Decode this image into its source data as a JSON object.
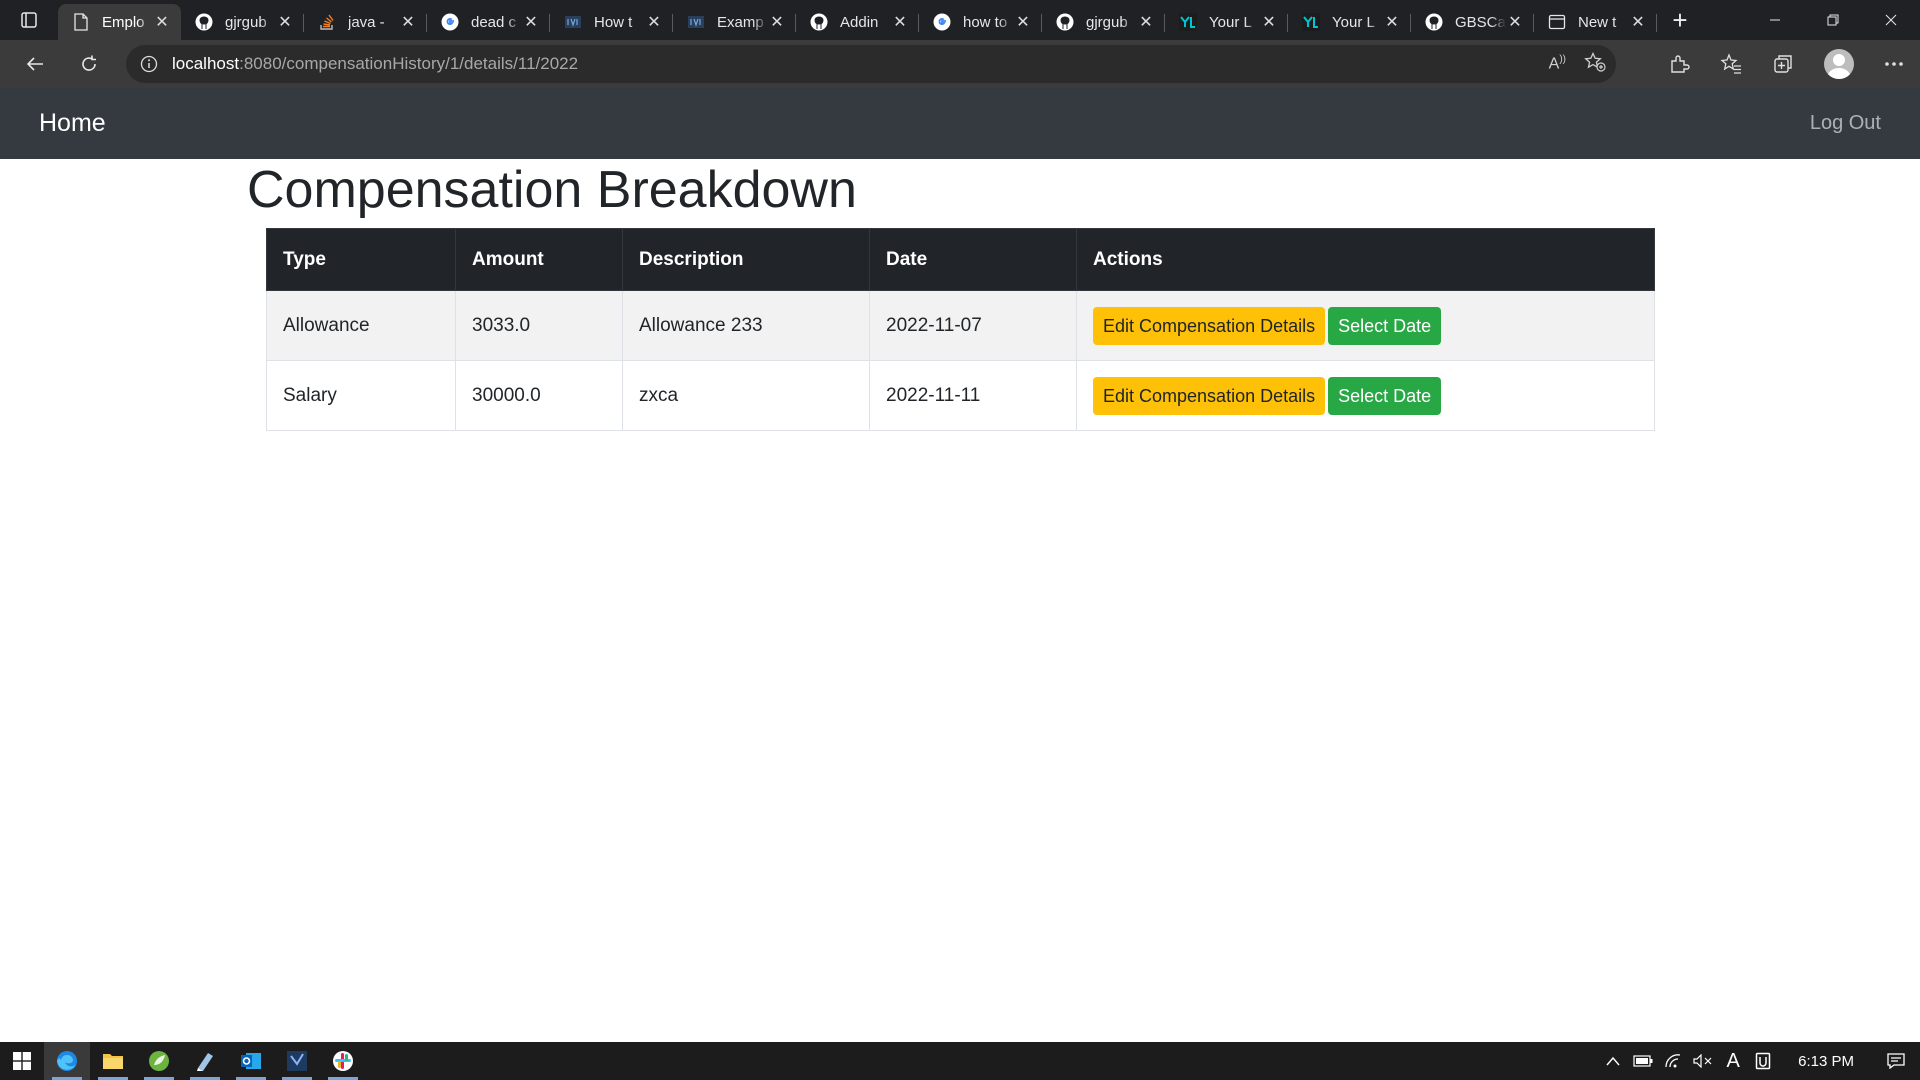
{
  "browser": {
    "tabs": [
      {
        "title": "Emplo",
        "icon": "page-icon",
        "active": true
      },
      {
        "title": "gjrgub",
        "icon": "github-icon"
      },
      {
        "title": "java -",
        "icon": "stackoverflow-icon"
      },
      {
        "title": "dead c",
        "icon": "google-icon"
      },
      {
        "title": "How t",
        "icon": "site-icon"
      },
      {
        "title": "Examp",
        "icon": "site-icon"
      },
      {
        "title": "Addin",
        "icon": "github-icon"
      },
      {
        "title": "how to",
        "icon": "google-icon"
      },
      {
        "title": "gjrgub",
        "icon": "github-icon"
      },
      {
        "title": "Your L",
        "icon": "yaml-icon"
      },
      {
        "title": "Your L",
        "icon": "yaml-icon"
      },
      {
        "title": "GBSCa",
        "icon": "github-icon"
      },
      {
        "title": "New t",
        "icon": "newtab-icon"
      }
    ],
    "url_host": "localhost",
    "url_path": ":8080/compensationHistory/1/details/11/2022"
  },
  "navbar": {
    "brand": "Home",
    "logout": "Log Out"
  },
  "page": {
    "title": "Compensation Breakdown",
    "table": {
      "headers": [
        "Type",
        "Amount",
        "Description",
        "Date",
        "Actions"
      ],
      "rows": [
        {
          "type": "Allowance",
          "amount": "3033.0",
          "description": "Allowance 233",
          "date": "2022-11-07",
          "edit_label": "Edit Compensation Details",
          "select_label": "Select Date"
        },
        {
          "type": "Salary",
          "amount": "30000.0",
          "description": "zxca",
          "date": "2022-11-11",
          "edit_label": "Edit Compensation Details",
          "select_label": "Select Date"
        }
      ]
    }
  },
  "taskbar": {
    "clock": "6:13 PM"
  },
  "colors": {
    "navbar": "#343a40",
    "table_header": "#212529",
    "warning": "#ffc107",
    "success": "#28a745"
  }
}
